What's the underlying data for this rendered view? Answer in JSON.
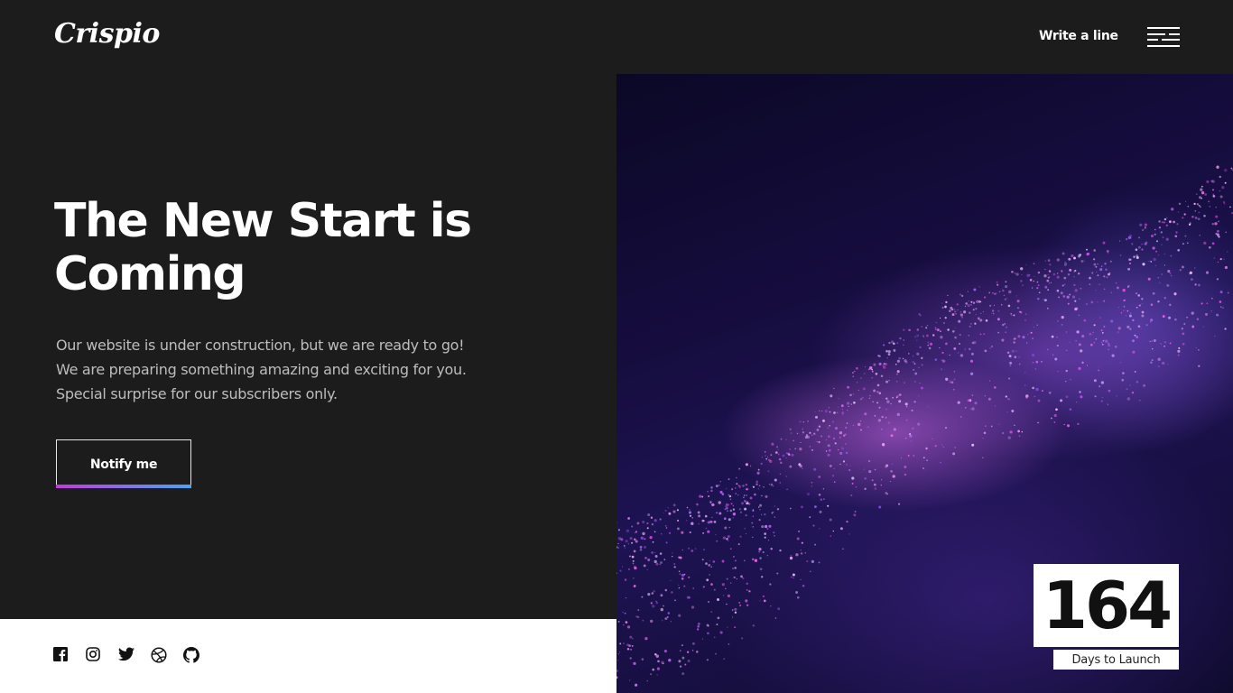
{
  "header": {
    "logo": "Crispio",
    "write_link": "Write a line",
    "menu_icon": "hamburger-menu-icon"
  },
  "hero": {
    "title": "The New Start is Coming",
    "lines": [
      "Our website is under construction, but we are ready to go!",
      "We are preparing something amazing and exciting for you.",
      "Special surprise for our subscribers only."
    ],
    "button_label": "Notify me",
    "button_gradient": [
      "#c23be0",
      "#4aa3f0"
    ]
  },
  "countdown": {
    "value": "164",
    "label": "Days to Launch"
  },
  "socials": [
    {
      "name": "facebook-icon"
    },
    {
      "name": "instagram-icon"
    },
    {
      "name": "twitter-icon"
    },
    {
      "name": "dribbble-icon"
    },
    {
      "name": "github-icon"
    }
  ],
  "colors": {
    "background": "#1c1c1c",
    "accent_purple": "#c23be0",
    "accent_blue": "#4aa3f0",
    "footer": "#ffffff"
  }
}
